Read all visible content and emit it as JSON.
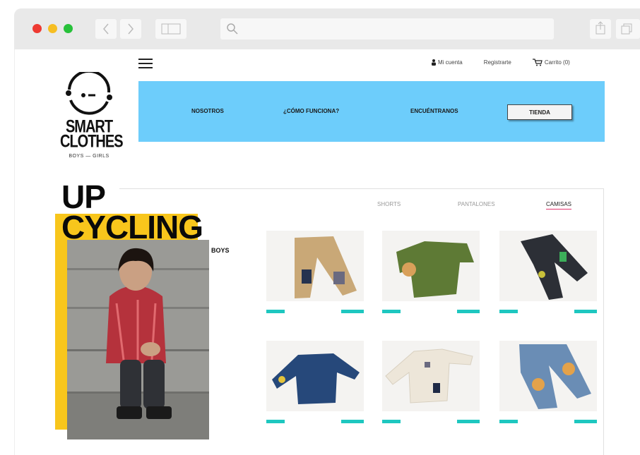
{
  "colors": {
    "menu_bg": "#6dcdfb",
    "accent_yellow": "#f8c61c",
    "tag_teal": "#1ec7c0",
    "active_underline": "#e2366d",
    "traffic_red": "#ee3a32",
    "traffic_yellow": "#f6be22",
    "traffic_green": "#27c13a"
  },
  "browser": {
    "icons": [
      "back-icon",
      "forward-icon",
      "sidebar-icon",
      "search-icon",
      "share-icon",
      "tabs-icon"
    ]
  },
  "header": {
    "account_label": "Mi cuenta",
    "register_label": "Registrarte",
    "cart_label": "Carrito (0)"
  },
  "logo": {
    "line1": "SMART",
    "line2": "CLOTHES",
    "sub": "BOYS — GIRLS"
  },
  "menu": {
    "items": [
      "NOSOTROS",
      "¿CÓMO FUNCIONA?",
      "ENCUÉNTRANOS"
    ],
    "tienda_label": "TIENDA"
  },
  "hero": {
    "title_line1": "UP",
    "title_line2": "CYCLING",
    "subtitle": "BOYS"
  },
  "categories": [
    {
      "label": "SHORTS",
      "active": false
    },
    {
      "label": "PANTALONES",
      "active": false
    },
    {
      "label": "CAMISAS",
      "active": true
    }
  ],
  "products": [
    {
      "name": "khaki-pants",
      "color": "#c9a877"
    },
    {
      "name": "green-sweater",
      "color": "#5e7a35"
    },
    {
      "name": "black-jeans",
      "color": "#2c2f36"
    },
    {
      "name": "denim-shirt",
      "color": "#26487a"
    },
    {
      "name": "white-sweater",
      "color": "#ede6d9"
    },
    {
      "name": "blue-jeans",
      "color": "#6a8db5"
    }
  ]
}
